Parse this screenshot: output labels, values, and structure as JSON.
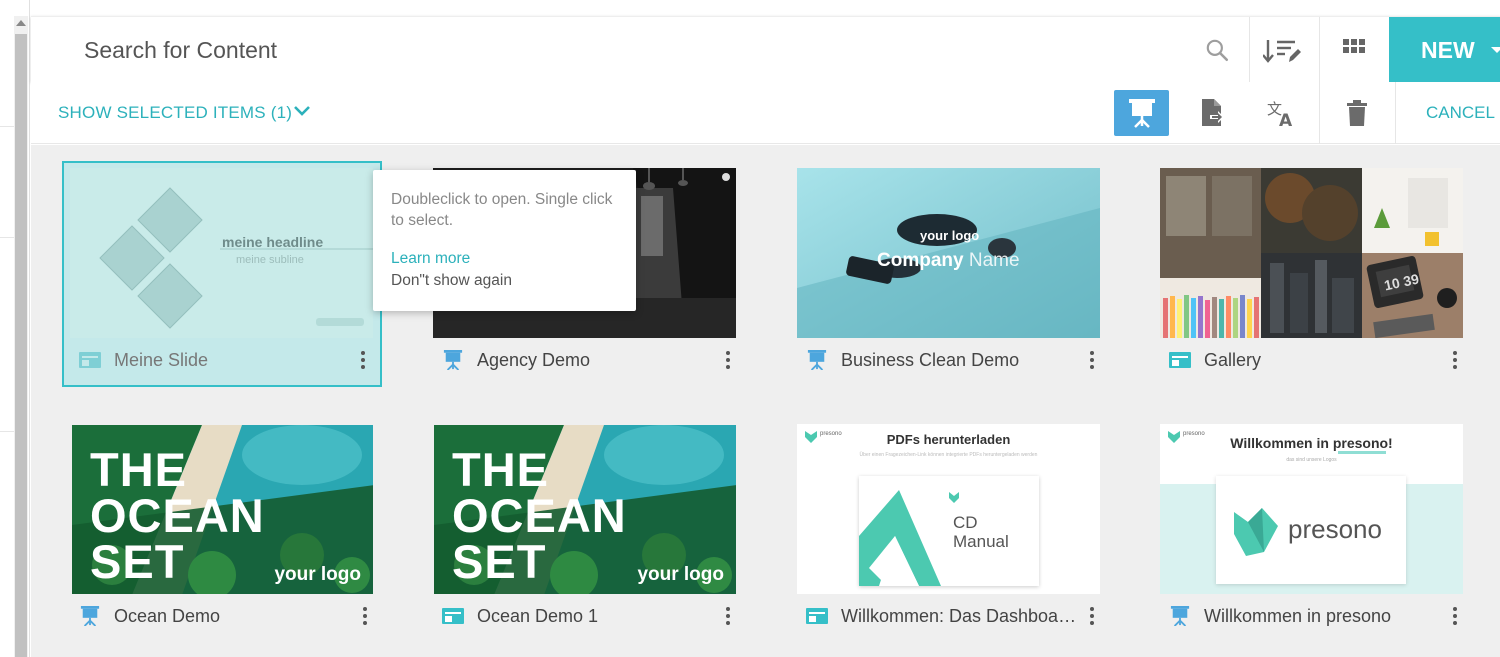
{
  "search": {
    "placeholder": "Search for Content"
  },
  "toolbar": {
    "new_label": "NEW"
  },
  "selection_bar": {
    "show_selected_label": "SHOW SELECTED ITEMS (1)",
    "cancel_label": "CANCEL"
  },
  "tooltip": {
    "text": "Doubleclick to open. Single click to select.",
    "learn_more": "Learn more",
    "dont_show": "Don\"t show again"
  },
  "cards": [
    {
      "title": "Meine Slide",
      "type": "slide",
      "selected": true,
      "thumb": {
        "headline": "meine headline",
        "subline": "meine subline"
      }
    },
    {
      "title": "Agency Demo",
      "type": "presentation",
      "selected": false
    },
    {
      "title": "Business Clean Demo",
      "type": "presentation",
      "selected": false,
      "thumb": {
        "logo": "your logo",
        "company": "Company",
        "name": "Name"
      }
    },
    {
      "title": "Gallery",
      "type": "slide",
      "selected": false,
      "thumb": {
        "clock": "10 39"
      }
    },
    {
      "title": "Ocean Demo",
      "type": "presentation",
      "selected": false,
      "thumb": {
        "line1": "THE",
        "line2": "OCEAN",
        "line3": "SET",
        "logo": "your logo"
      }
    },
    {
      "title": "Ocean Demo 1",
      "type": "slide",
      "selected": false,
      "thumb": {
        "line1": "THE",
        "line2": "OCEAN",
        "line3": "SET",
        "logo": "your logo"
      }
    },
    {
      "title": "Willkommen: Das Dashboa…",
      "type": "slide",
      "selected": false,
      "thumb": {
        "heading": "PDFs herunterladen",
        "sub": "Über einen Fragezeichen-Link können integrierte PDFs heruntergeladen werden",
        "brand": "presono",
        "doc_line1": "CD",
        "doc_line2": "Manual"
      }
    },
    {
      "title": "Willkommen in presono",
      "type": "presentation",
      "selected": false,
      "thumb": {
        "heading": "Willkommen in presono!",
        "sub": "das sind unsere Logos",
        "brand": "presono",
        "logo_text": "presono"
      }
    }
  ],
  "colors": {
    "accent": "#35bfc8",
    "active_tool": "#4da6dd",
    "selected_bg": "#c4e9ea",
    "presentation_icon": "#4da6dd",
    "slide_icon": "#35bfc8"
  }
}
